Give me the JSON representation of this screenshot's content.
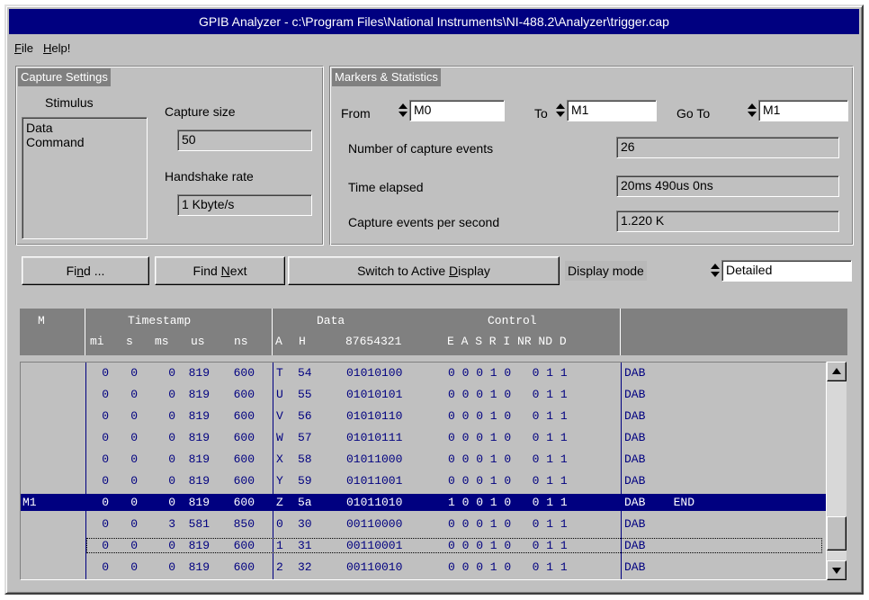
{
  "window": {
    "title": "GPIB Analyzer - c:\\Program Files\\National Instruments\\NI-488.2\\Analyzer\\trigger.cap"
  },
  "menu": [
    {
      "label": "File",
      "mnemonic": "F",
      "rest": "ile"
    },
    {
      "label": "Help!",
      "mnemonic": "H",
      "rest": "elp!"
    }
  ],
  "capture": {
    "title": "Capture Settings",
    "stimulus_label": "Stimulus",
    "stimulus_items": [
      "Data",
      "Command"
    ],
    "size_label": "Capture size",
    "size_value": "50",
    "rate_label": "Handshake rate",
    "rate_value": "1 Kbyte/s"
  },
  "markers": {
    "title": "Markers & Statistics",
    "from_label": "From",
    "from_value": "M0",
    "to_label": "To",
    "to_value": "M1",
    "goto_label": "Go To",
    "goto_value": "M1",
    "events_label": "Number of capture events",
    "events_value": "26",
    "elapsed_label": "Time elapsed",
    "elapsed_value": "20ms 490us   0ns",
    "rate_label": "Capture events per second",
    "rate_value": "1.220 K"
  },
  "toolbar": {
    "find_pre": "Fi",
    "find_mn": "n",
    "find_post": "d ...",
    "findnext_pre": "Find ",
    "findnext_mn": "N",
    "findnext_post": "ext",
    "switch_pre": "Switch to Active ",
    "switch_mn": "D",
    "switch_post": "isplay",
    "display_mode_label": "Display mode",
    "display_mode_value": "Detailed"
  },
  "grid": {
    "headers": {
      "m": "M",
      "timestamp": "Timestamp",
      "data": "Data",
      "control": "Control",
      "mi": "mi",
      "s": "s",
      "ms": "ms",
      "us": "us",
      "ns": "ns",
      "a": "A",
      "h": "H",
      "bits": "87654321",
      "ctrl": "E A S R I NR ND D"
    },
    "rows": [
      {
        "m": "",
        "mi": "0",
        "s": "0",
        "ms": "0",
        "us": "819",
        "ns": "600",
        "a": "T",
        "h": "54",
        "bits": "01010100",
        "ctrl": "0 0 0 1 0   0 1 1",
        "desc": "DAB"
      },
      {
        "m": "",
        "mi": "0",
        "s": "0",
        "ms": "0",
        "us": "819",
        "ns": "600",
        "a": "U",
        "h": "55",
        "bits": "01010101",
        "ctrl": "0 0 0 1 0   0 1 1",
        "desc": "DAB"
      },
      {
        "m": "",
        "mi": "0",
        "s": "0",
        "ms": "0",
        "us": "819",
        "ns": "600",
        "a": "V",
        "h": "56",
        "bits": "01010110",
        "ctrl": "0 0 0 1 0   0 1 1",
        "desc": "DAB"
      },
      {
        "m": "",
        "mi": "0",
        "s": "0",
        "ms": "0",
        "us": "819",
        "ns": "600",
        "a": "W",
        "h": "57",
        "bits": "01010111",
        "ctrl": "0 0 0 1 0   0 1 1",
        "desc": "DAB"
      },
      {
        "m": "",
        "mi": "0",
        "s": "0",
        "ms": "0",
        "us": "819",
        "ns": "600",
        "a": "X",
        "h": "58",
        "bits": "01011000",
        "ctrl": "0 0 0 1 0   0 1 1",
        "desc": "DAB"
      },
      {
        "m": "",
        "mi": "0",
        "s": "0",
        "ms": "0",
        "us": "819",
        "ns": "600",
        "a": "Y",
        "h": "59",
        "bits": "01011001",
        "ctrl": "0 0 0 1 0   0 1 1",
        "desc": "DAB"
      },
      {
        "m": "M1",
        "mi": "0",
        "s": "0",
        "ms": "0",
        "us": "819",
        "ns": "600",
        "a": "Z",
        "h": "5a",
        "bits": "01011010",
        "ctrl": "1 0 0 1 0   0 1 1",
        "desc": "DAB    END",
        "selected": true
      },
      {
        "m": "",
        "mi": "0",
        "s": "0",
        "ms": "3",
        "us": "581",
        "ns": "850",
        "a": "0",
        "h": "30",
        "bits": "00110000",
        "ctrl": "0 0 0 1 0   0 1 1",
        "desc": "DAB"
      },
      {
        "m": "",
        "mi": "0",
        "s": "0",
        "ms": "0",
        "us": "819",
        "ns": "600",
        "a": "1",
        "h": "31",
        "bits": "00110001",
        "ctrl": "0 0 0 1 0   0 1 1",
        "desc": "DAB",
        "focused": true
      },
      {
        "m": "",
        "mi": "0",
        "s": "0",
        "ms": "0",
        "us": "819",
        "ns": "600",
        "a": "2",
        "h": "32",
        "bits": "00110010",
        "ctrl": "0 0 0 1 0   0 1 1",
        "desc": "DAB"
      }
    ]
  },
  "scrollbar": {
    "up_icon": "arrow-up-icon",
    "down_icon": "arrow-down-icon"
  }
}
